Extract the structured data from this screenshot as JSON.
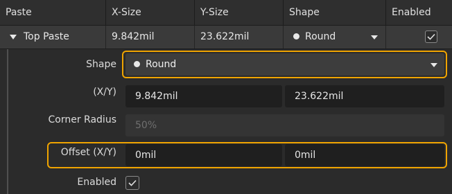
{
  "header": {
    "columns": [
      "Paste",
      "X-Size",
      "Y-Size",
      "Shape",
      "Enabled"
    ]
  },
  "row": {
    "name": "Top Paste",
    "x_size": "9.842mil",
    "y_size": "23.622mil",
    "shape": "Round",
    "enabled": true
  },
  "details": {
    "shape_label": "Shape",
    "shape_value": "Round",
    "size_label": "(X/Y)",
    "size_x": "9.842mil",
    "size_y": "23.622mil",
    "corner_label": "Corner Radius",
    "corner_value": "50%",
    "offset_label": "Offset (X/Y)",
    "offset_x": "0mil",
    "offset_y": "0mil",
    "enabled_label": "Enabled",
    "enabled": true
  },
  "colors": {
    "highlight": "#f0a400",
    "background": "#2b2b2b"
  }
}
